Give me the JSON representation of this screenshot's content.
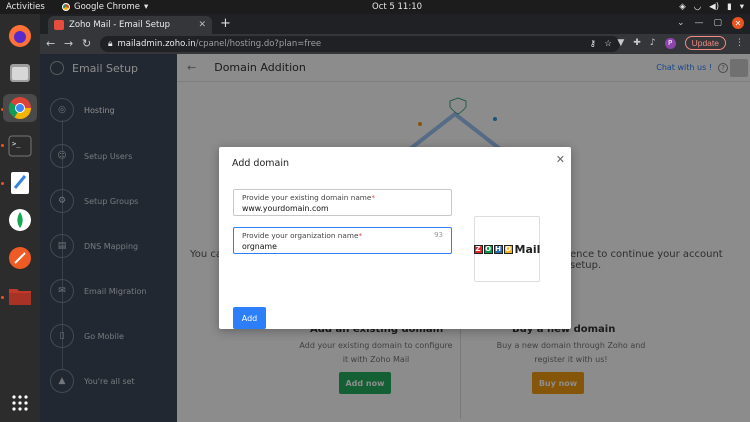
{
  "topbar": {
    "activities": "Activities",
    "app_name": "Google Chrome",
    "clock": "Oct 5  11:10"
  },
  "browser": {
    "tab_title": "Zoho Mail - Email Setup",
    "url_domain": "mailadmin.zoho.in",
    "url_path": "/cpanel/hosting.do?plan=free",
    "update_label": "Update",
    "avatar_letter": "P"
  },
  "sidebar": {
    "title": "Email Setup",
    "steps": [
      {
        "label": "Hosting"
      },
      {
        "label": "Setup Users"
      },
      {
        "label": "Setup Groups"
      },
      {
        "label": "DNS Mapping"
      },
      {
        "label": "Email Migration"
      },
      {
        "label": "Go Mobile"
      },
      {
        "label": "You're all set"
      }
    ]
  },
  "main": {
    "title": "Domain Addition",
    "chat_label": "Chat with us !",
    "bg_text_left": "You ca",
    "bg_text_right": "ence to continue your account setup.",
    "option_existing": {
      "title": "Add an existing domain",
      "desc1": "Add your existing domain to configure",
      "desc2": "it with Zoho Mail",
      "button": "Add now",
      "color": "#27ae60"
    },
    "option_new": {
      "title": "Buy a new domain",
      "desc1": "Buy a new domain through Zoho and",
      "desc2": "register it with us!",
      "button": "Buy now",
      "color": "#f39c12"
    }
  },
  "modal": {
    "title": "Add domain",
    "domain_field": {
      "label": "Provide your existing domain name",
      "value": "www.yourdomain.com"
    },
    "org_field": {
      "label": "Provide your organization name",
      "value": "orgname",
      "char_count": "93"
    },
    "add_button": "Add",
    "logo_letters": [
      "Z",
      "O",
      "H",
      "O"
    ],
    "logo_colors": [
      "#e42527",
      "#089949",
      "#226db4",
      "#f9b21d"
    ],
    "logo_word": "Mail",
    "accent_color": "#2d7ff9"
  }
}
